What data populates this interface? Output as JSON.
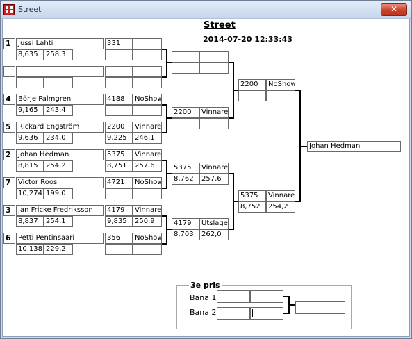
{
  "window": {
    "title": "Street",
    "close_label": "✕"
  },
  "header": {
    "title": "Street",
    "datetime": "2014-07-20 12:33:43"
  },
  "round1": [
    {
      "seed": "1",
      "name": "Jussi Lahti",
      "time": "8,635",
      "speed": "258,3"
    },
    {
      "seed": "",
      "name": "",
      "time": "",
      "speed": ""
    },
    {
      "seed": "4",
      "name": "Börje Palmgren",
      "time": "9,165",
      "speed": "243,4"
    },
    {
      "seed": "5",
      "name": "Rickard Engström",
      "time": "9,636",
      "speed": "234,0"
    },
    {
      "seed": "2",
      "name": "Johan Hedman",
      "time": "8,815",
      "speed": "254,2"
    },
    {
      "seed": "7",
      "name": "Victor Roos",
      "time": "10,274",
      "speed": "199,0"
    },
    {
      "seed": "3",
      "name": "Jan Fricke  Fredriksson",
      "time": "8,837",
      "speed": "254,1"
    },
    {
      "seed": "6",
      "name": "Petti Pentinsaari",
      "time": "10,138",
      "speed": "229,2"
    }
  ],
  "round1_results": [
    {
      "number": "331",
      "status": "",
      "time": "",
      "speed": ""
    },
    {
      "number": "",
      "status": "",
      "time": "",
      "speed": ""
    },
    {
      "number": "4188",
      "status": "NoShow",
      "time": "",
      "speed": ""
    },
    {
      "number": "2200",
      "status": "Vinnare",
      "time": "9,225",
      "speed": "246,1"
    },
    {
      "number": "5375",
      "status": "Vinnare",
      "time": "8,751",
      "speed": "257,6"
    },
    {
      "number": "4721",
      "status": "NoShow",
      "time": "",
      "speed": ""
    },
    {
      "number": "4179",
      "status": "Vinnare",
      "time": "9,835",
      "speed": "250,9"
    },
    {
      "number": "356",
      "status": "NoShow",
      "time": "",
      "speed": ""
    }
  ],
  "quarterfinals": [
    {
      "number": "",
      "status": "",
      "time": "",
      "speed": ""
    },
    {
      "number": "2200",
      "status": "Vinnare",
      "time": "",
      "speed": ""
    },
    {
      "number": "5375",
      "status": "Vinnare",
      "time": "8,762",
      "speed": "257,6"
    },
    {
      "number": "4179",
      "status": "Utslagen",
      "time": "8,703",
      "speed": "262,0"
    }
  ],
  "semifinals": [
    {
      "number": "2200",
      "status": "NoShow",
      "time": "",
      "speed": ""
    },
    {
      "number": "5375",
      "status": "Vinnare",
      "time": "8,752",
      "speed": "254,2"
    }
  ],
  "final": {
    "winner": "Johan Hedman"
  },
  "third_place": {
    "title": "3e pris",
    "lanes": [
      {
        "label": "Bana 1",
        "a": "",
        "b": ""
      },
      {
        "label": "Bana 2",
        "a": "",
        "b": ""
      }
    ],
    "result": ""
  }
}
